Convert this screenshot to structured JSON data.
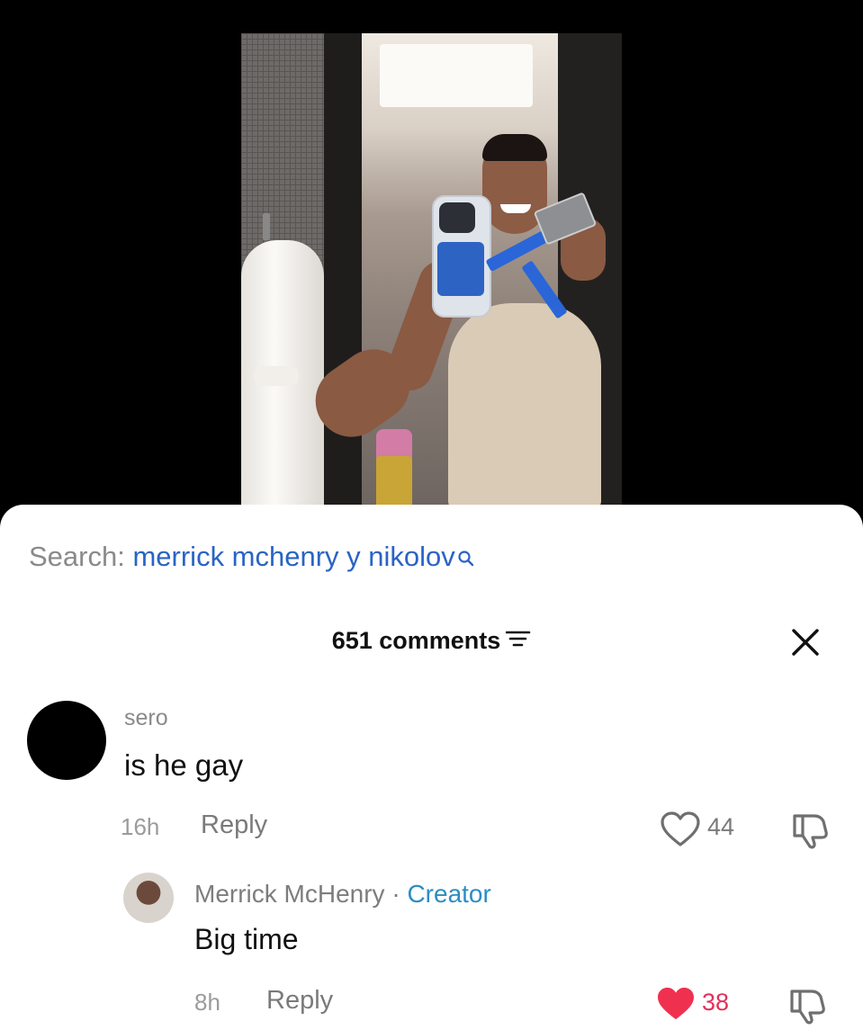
{
  "search": {
    "prefix": "Search:",
    "query": "merrick mchenry y nikolov"
  },
  "comments": {
    "count_label": "651 comments"
  },
  "comment": {
    "username": "sero",
    "text": "is he gay",
    "time": "16h",
    "reply_label": "Reply",
    "likes": "44"
  },
  "reply": {
    "username": "Merrick McHenry",
    "separator": "·",
    "badge": "Creator",
    "text": "Big time",
    "time": "8h",
    "reply_label": "Reply",
    "likes": "38"
  },
  "colors": {
    "search_query": "#2a64c4",
    "creator_badge": "#2b8dc4",
    "liked_heart": "#f0304f"
  },
  "icons": [
    "search-icon",
    "filter-icon",
    "close-icon",
    "heart-outline-icon",
    "dislike-icon",
    "heart-filled-icon"
  ]
}
